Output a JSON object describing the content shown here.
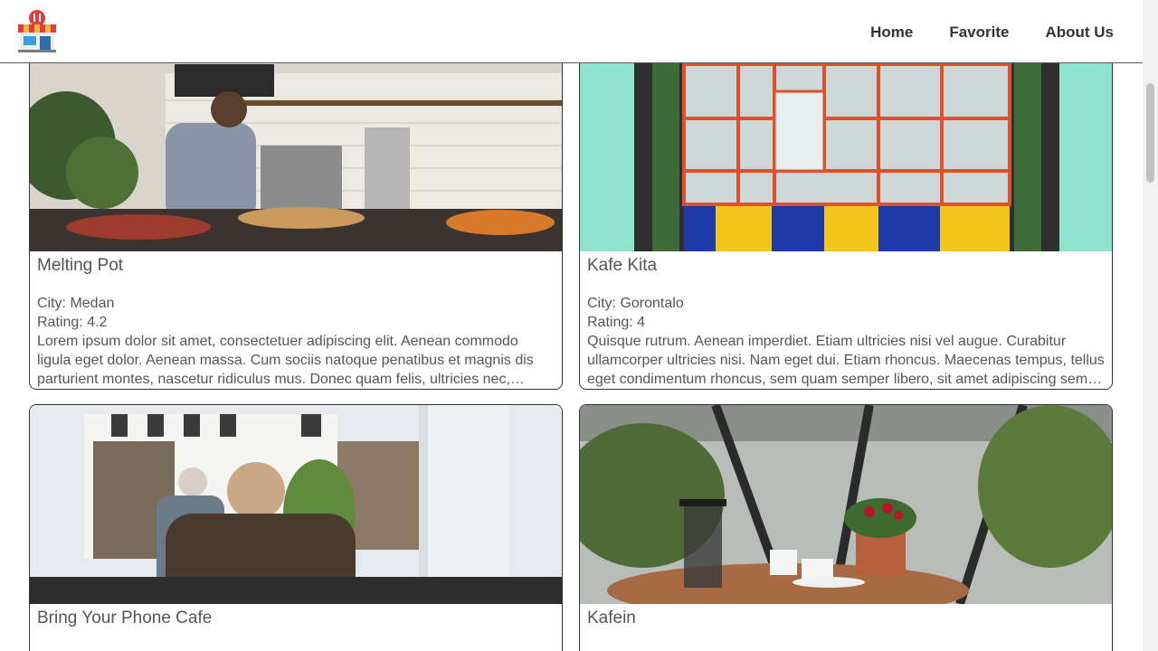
{
  "header": {
    "logo_icon": "shop-storefront-icon",
    "nav": [
      {
        "label": "Home"
      },
      {
        "label": "Favorite"
      },
      {
        "label": "About Us"
      }
    ]
  },
  "restaurants": [
    {
      "name": "Melting Pot",
      "city": "City: Medan",
      "rating": "Rating: 4.2",
      "description": "Lorem ipsum dolor sit amet, consectetuer adipiscing elit. Aenean commodo ligula eget dolor. Aenean massa. Cum sociis natoque penatibus et magnis dis parturient montes, nascetur ridiculus mus. Donec quam felis, ultricies nec, pellentesque eu, pretium quis, sem."
    },
    {
      "name": "Kafe Kita",
      "city": "City: Gorontalo",
      "rating": "Rating: 4",
      "description": "Quisque rutrum. Aenean imperdiet. Etiam ultricies nisi vel augue. Curabitur ullamcorper ultricies nisi. Nam eget dui. Etiam rhoncus. Maecenas tempus, tellus eget condimentum rhoncus, sem quam semper libero, sit amet adipiscing sem neque sed ipsum."
    },
    {
      "name": "Bring Your Phone Cafe",
      "city": "",
      "rating": "",
      "description": ""
    },
    {
      "name": "Kafein",
      "city": "",
      "rating": "",
      "description": ""
    }
  ]
}
